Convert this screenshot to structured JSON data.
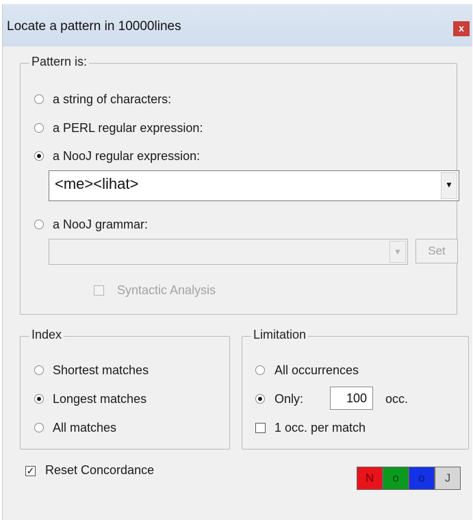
{
  "window": {
    "title": "Locate a pattern in 10000lines",
    "close_label": "x"
  },
  "pattern": {
    "legend": "Pattern is:",
    "options": {
      "string": "a string of characters:",
      "perl": "a PERL regular expression:",
      "nooj_regex": "a NooJ regular expression:",
      "nooj_grammar": "a NooJ grammar:"
    },
    "selected": "nooj_regex",
    "regex_value": "<me><lihat>",
    "grammar_value": "",
    "set_label": "Set",
    "syntactic_label": "Syntactic Analysis",
    "syntactic_checked": false
  },
  "index": {
    "legend": "Index",
    "options": {
      "shortest": "Shortest matches",
      "longest": "Longest matches",
      "all": "All matches"
    },
    "selected": "longest"
  },
  "limitation": {
    "legend": "Limitation",
    "all_label": "All occurrences",
    "only_label": "Only:",
    "only_value": "100",
    "occ_label": "occ.",
    "per_match_label": "1 occ. per match",
    "per_match_checked": false,
    "selected": "only"
  },
  "reset": {
    "label": "Reset Concordance",
    "checked": true
  },
  "nooj_buttons": [
    {
      "label": "N",
      "bg": "#e8131b",
      "fg": "#7a0000"
    },
    {
      "label": "o",
      "bg": "#0b9a1e",
      "fg": "#064a0d"
    },
    {
      "label": "o",
      "bg": "#1432e6",
      "fg": "#0a1a78"
    },
    {
      "label": "J",
      "bg": "#d6d6d6",
      "fg": "#4a4a4a"
    }
  ]
}
